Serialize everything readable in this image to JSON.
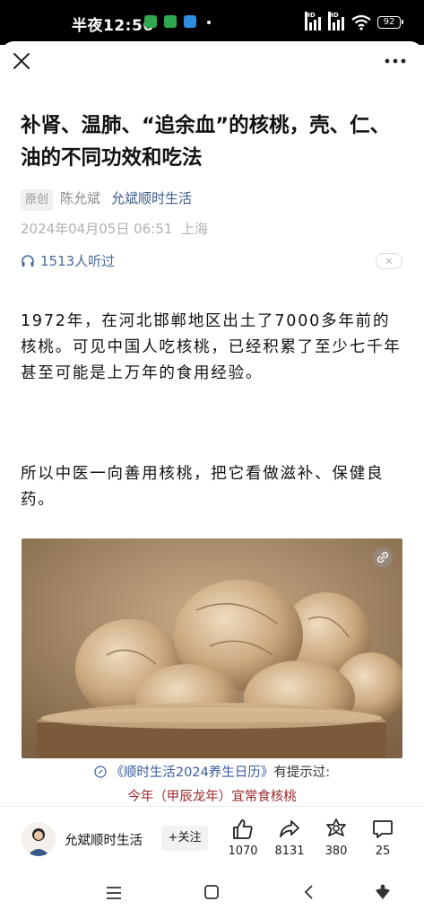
{
  "status_bar": {
    "time": "半夜12:56",
    "battery": "92",
    "signal_label": "HD"
  },
  "article": {
    "title": "补肾、温肺、“追余血”的核桃，壳、仁、油的不同功效和吃法",
    "badge": "原创",
    "author": "陈允斌",
    "source": "允斌顺时生活",
    "date": "2024年04月05日 06:51",
    "location": "上海",
    "listen_count": "1513人听过",
    "paragraphs": [
      "1972年，在河北邯郸地区出土了7000多年前的核桃。可见中国人吃核桃，已经积累了至少七千年甚至可能是上万年的食用经验。",
      "所以中医一向善用核桃，把它看做滋补、保健良药。"
    ],
    "caption_link": "《顺时生活2024养生日历》",
    "caption_hint": "有提示过:",
    "caption_line2": "今年（甲辰龙年）宜常食核桃"
  },
  "bottom_bar": {
    "account_name": "允斌顺时生活",
    "follow_label": "+关注",
    "likes": "1070",
    "shares": "8131",
    "favorites": "380",
    "comments": "25"
  },
  "icons": [
    "close-icon",
    "more-icon",
    "headphone-icon",
    "link-icon",
    "like-icon",
    "share-icon",
    "favorite-icon",
    "comment-icon",
    "nav-menu-icon",
    "nav-home-icon",
    "nav-back-icon",
    "nav-assistant-icon"
  ],
  "colors": {
    "accent_blue": "#3a5a8c",
    "caption_red": "#9a2a2a",
    "meta_gray": "#b0b0b0"
  }
}
